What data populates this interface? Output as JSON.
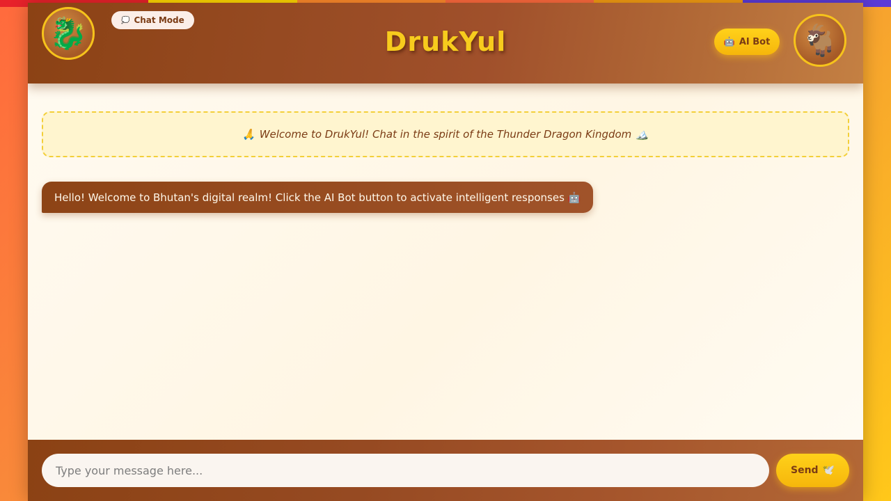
{
  "colors": {
    "brand_brown": "#8b4214",
    "accent_gold": "#f7cc1d",
    "button_yellow": "#ffd11a",
    "background_cream": "#fffbf0",
    "stripe": [
      "#e8222b",
      "#ffd700",
      "#ff8a2b",
      "#ff6a3d",
      "#f39c12",
      "#5b3bd6"
    ]
  },
  "header": {
    "left_emblem": "🐉",
    "left_emblem_icon": "dragon-icon",
    "chat_mode": {
      "icon": "💭",
      "icon_name": "thought-bubble-icon",
      "label": "Chat Mode"
    },
    "title": "DrukYul",
    "ai_bot": {
      "icon": "🤖",
      "icon_name": "robot-icon",
      "label": "AI Bot"
    },
    "right_emblem": "🐐",
    "right_emblem_icon": "takin-goat-icon"
  },
  "welcome": {
    "prefix_icon": "🙏",
    "prefix_icon_name": "folded-hands-icon",
    "text": "Welcome to DrukYul! Chat in the spirit of the Thunder Dragon Kingdom",
    "suffix_icon": "🏔️",
    "suffix_icon_name": "mountain-icon"
  },
  "messages": [
    {
      "sender": "bot",
      "text": "Hello! Welcome to Bhutan's digital realm! Click the AI Bot button to activate intelligent responses 🤖"
    }
  ],
  "composer": {
    "placeholder": "Type your message here...",
    "value": "",
    "send_label": "Send",
    "send_icon": "🕊️",
    "send_icon_name": "dove-icon"
  }
}
